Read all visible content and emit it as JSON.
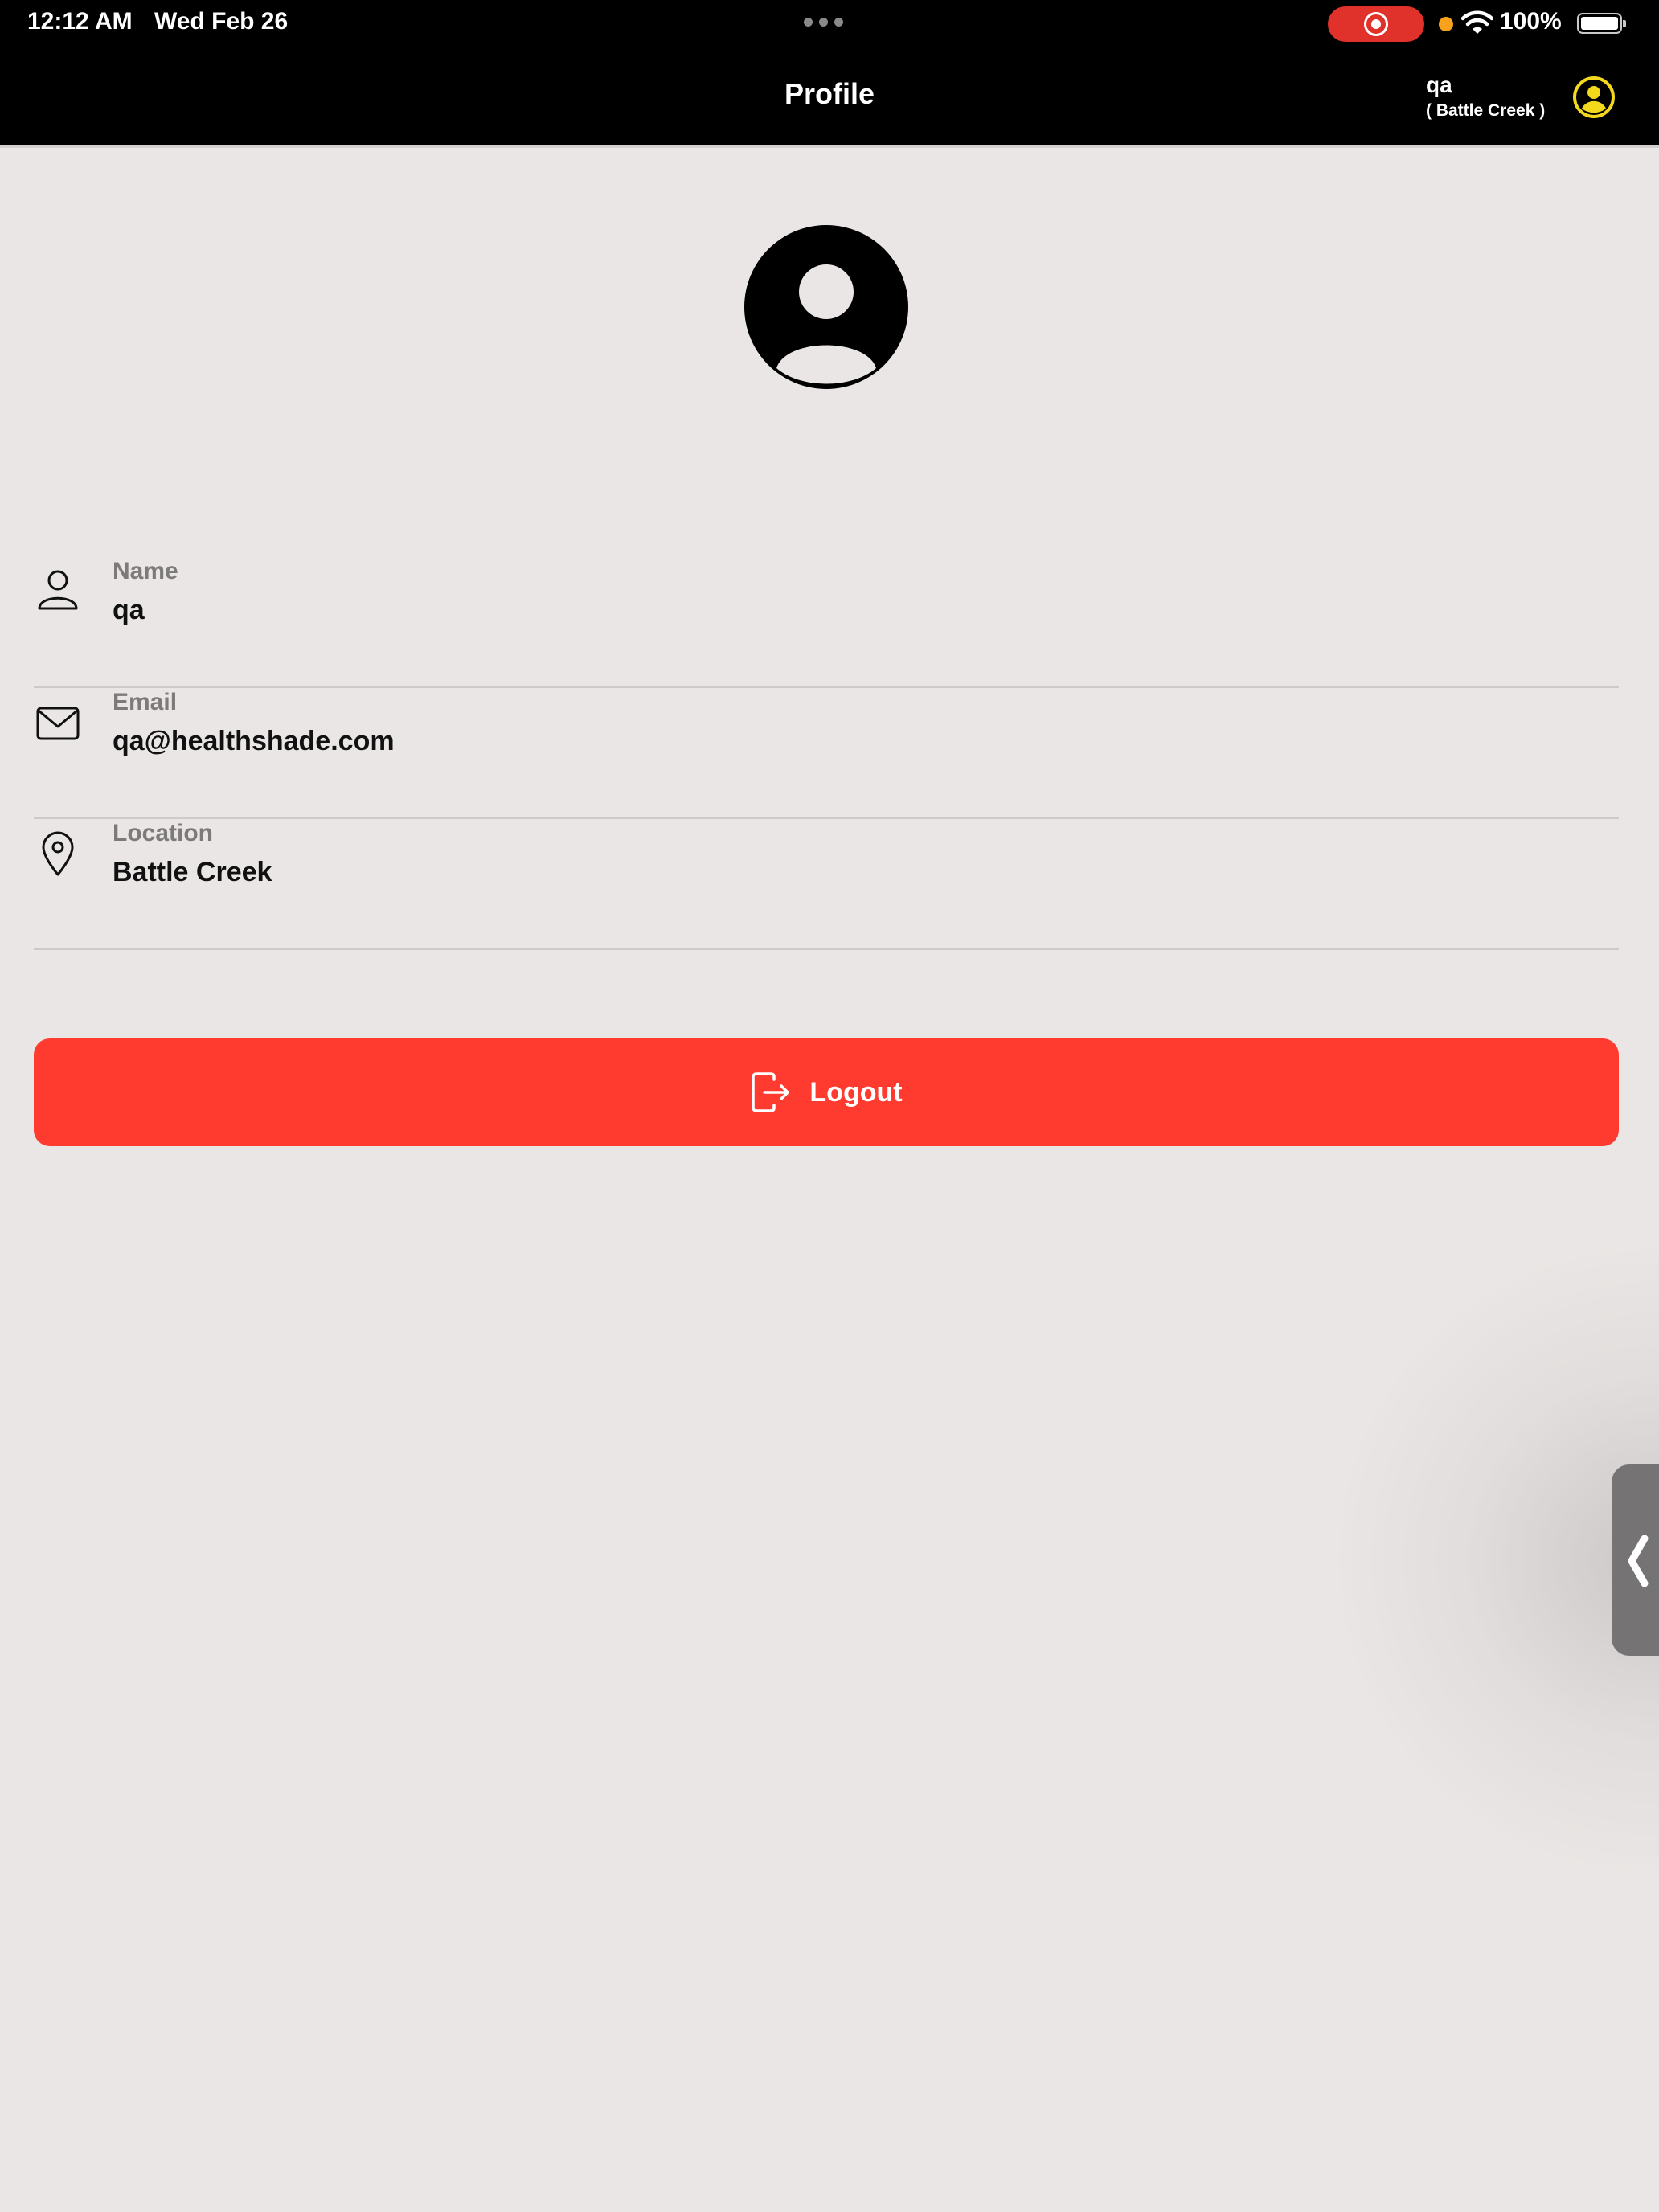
{
  "status_bar": {
    "time": "12:12 AM",
    "date": "Wed Feb 26",
    "battery_percent": "100%",
    "battery_level": 1.0,
    "icons": [
      "more-dots-icon",
      "screen-record-icon",
      "orange-dot-indicator",
      "wifi-icon",
      "battery-icon"
    ],
    "colors": {
      "record": "#e0312b",
      "indicator": "#f7a21a"
    }
  },
  "header": {
    "title": "Profile",
    "user_name": "qa",
    "user_location": "( Battle Creek )",
    "avatar_icon": "user-circle-icon",
    "avatar_color": "#f2d91c"
  },
  "profile": {
    "avatar_icon": "user-circle-icon",
    "fields": [
      {
        "icon": "person-icon",
        "label": "Name",
        "value": "qa"
      },
      {
        "icon": "mail-icon",
        "label": "Email",
        "value": "qa@healthshade.com"
      },
      {
        "icon": "location-pin-icon",
        "label": "Location",
        "value": "Battle Creek"
      }
    ]
  },
  "logout": {
    "label": "Logout",
    "icon": "logout-icon",
    "color": "#ff3b30"
  },
  "side_handle": {
    "icon": "chevron-left-icon"
  }
}
